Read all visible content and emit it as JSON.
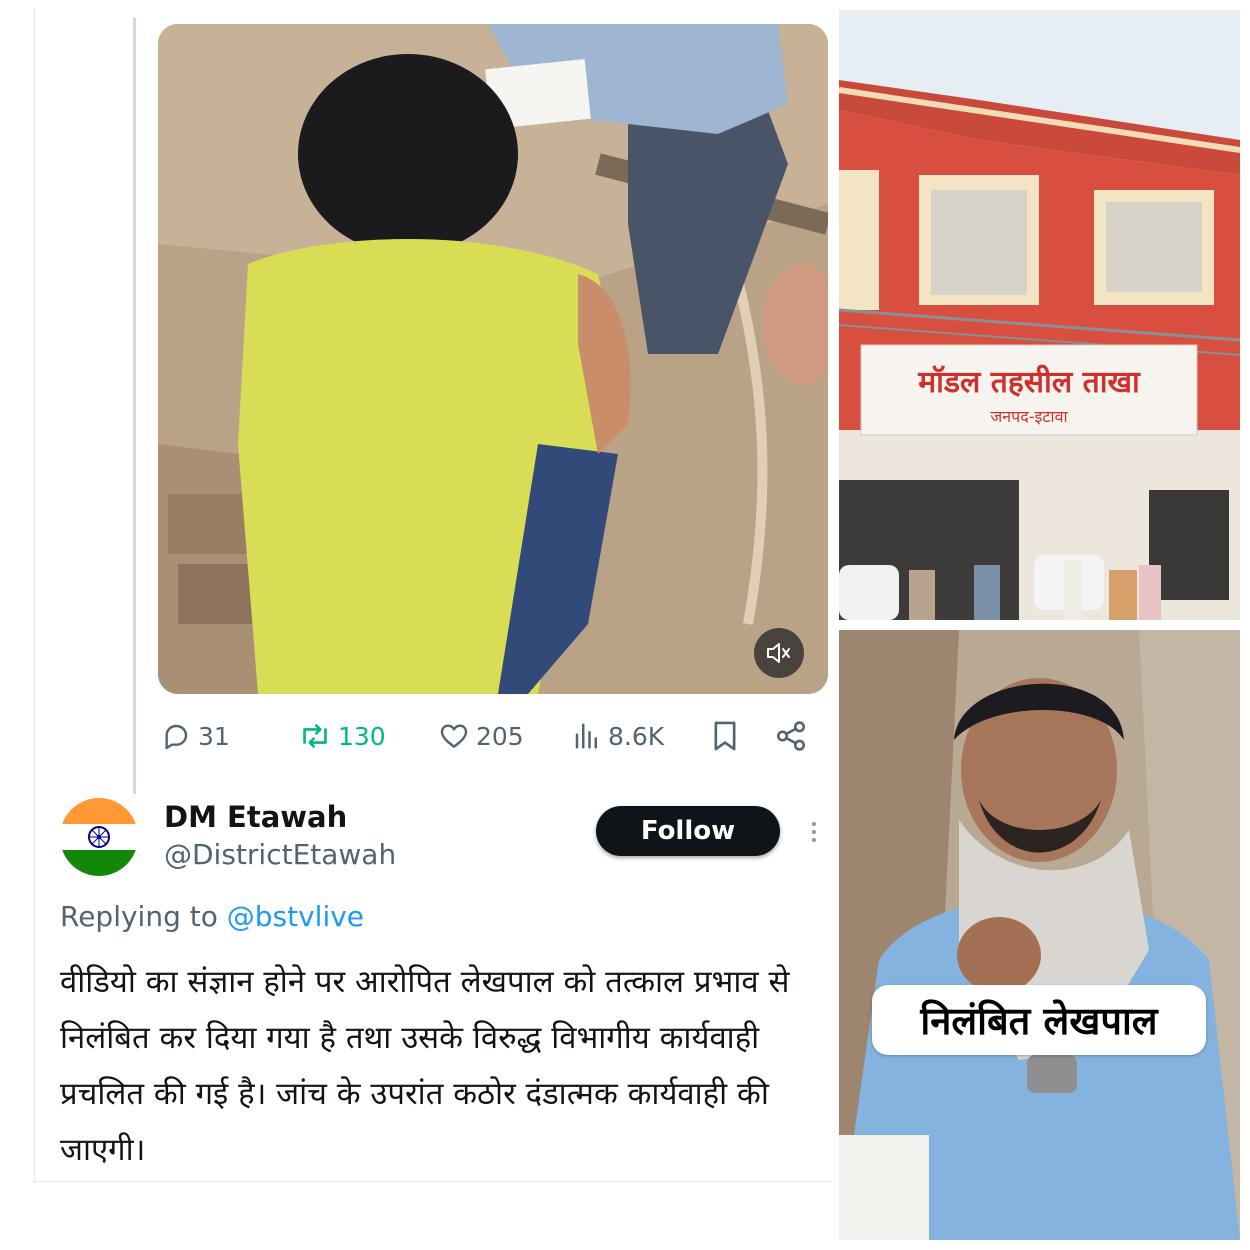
{
  "tweet": {
    "metrics": {
      "replies": "31",
      "retweets": "130",
      "likes": "205",
      "views": "8.6K"
    },
    "author": {
      "display_name": "DM Etawah",
      "handle": "@DistrictEtawah",
      "avatar": "india-flag"
    },
    "follow_label": "Follow",
    "replying_to_label": "Replying to",
    "replying_to_handle": "@bstvlive",
    "text": "वीडियो का संज्ञान होने पर आरोपित लेखपाल को तत्काल प्रभाव से निलंबित कर दिया गया है तथा उसके विरुद्ध विभागीय कार्यवाही प्रचलित की गई है। जांच के उपरांत कठोर दंडात्मक कार्यवाही की जाएगी।",
    "video": {
      "muted": true,
      "mute_icon": "speaker-muted-icon"
    }
  },
  "images": {
    "building_sign": "मॉडल तहसील ताखा",
    "building_subsign": "जनपद-इटावा",
    "man_caption": "निलंबित लेखपाल"
  },
  "colors": {
    "retweet_green": "#00ba7c",
    "link_blue": "#1d9bf0",
    "muted_gray": "#536471",
    "follow_bg": "#0f1419",
    "building_red": "#d94a3a"
  },
  "icons": [
    "reply-icon",
    "retweet-icon",
    "like-icon",
    "views-icon",
    "bookmark-icon",
    "share-icon",
    "more-icon"
  ]
}
